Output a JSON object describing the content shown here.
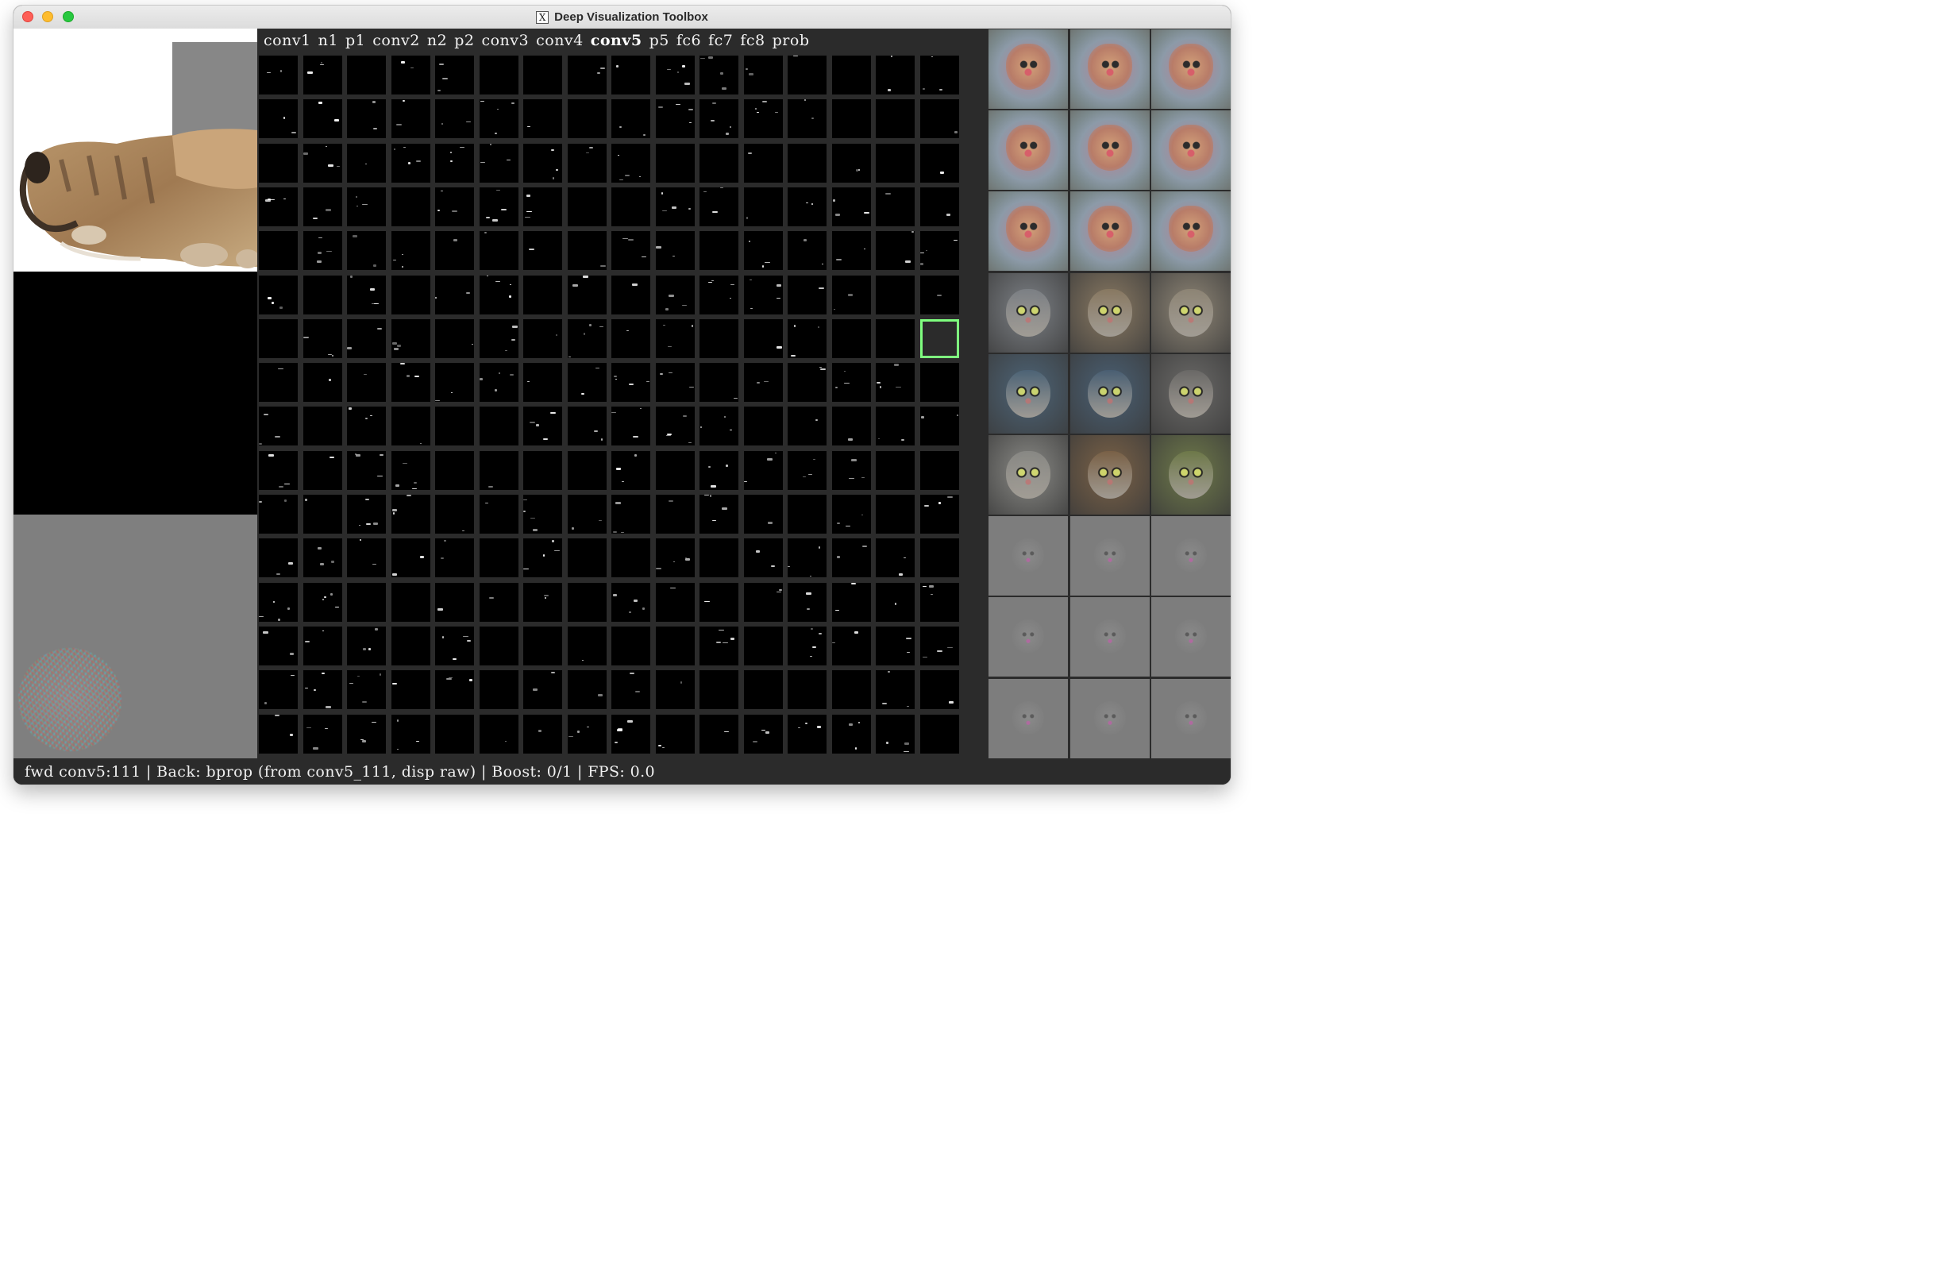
{
  "window": {
    "title": "Deep Visualization Toolbox",
    "title_icon": "X"
  },
  "layers": [
    {
      "label": "conv1",
      "active": false
    },
    {
      "label": "n1",
      "active": false
    },
    {
      "label": "p1",
      "active": false
    },
    {
      "label": "conv2",
      "active": false
    },
    {
      "label": "n2",
      "active": false
    },
    {
      "label": "p2",
      "active": false
    },
    {
      "label": "conv3",
      "active": false
    },
    {
      "label": "conv4",
      "active": false
    },
    {
      "label": "conv5",
      "active": true
    },
    {
      "label": "p5",
      "active": false
    },
    {
      "label": "fc6",
      "active": false
    },
    {
      "label": "fc7",
      "active": false
    },
    {
      "label": "fc8",
      "active": false
    },
    {
      "label": "prob",
      "active": false
    }
  ],
  "activation_grid": {
    "selected_unit": 111,
    "highlight_color": "#7fff7f"
  },
  "right_panel": {
    "tiles": [
      {
        "kind": "deepvis"
      },
      {
        "kind": "deepvis"
      },
      {
        "kind": "deepvis"
      },
      {
        "kind": "deepvis"
      },
      {
        "kind": "deepvis"
      },
      {
        "kind": "deepvis"
      },
      {
        "kind": "deepvis"
      },
      {
        "kind": "deepvis"
      },
      {
        "kind": "deepvis"
      },
      {
        "kind": "photo",
        "color": "#7d8186"
      },
      {
        "kind": "photo",
        "color": "#8a7a63"
      },
      {
        "kind": "photo",
        "color": "#8f8676"
      },
      {
        "kind": "photo",
        "color": "#4d6477"
      },
      {
        "kind": "photo",
        "color": "#4a6074"
      },
      {
        "kind": "photo",
        "color": "#6b6a68"
      },
      {
        "kind": "photo",
        "color": "#8a8a86"
      },
      {
        "kind": "photo",
        "color": "#7b6247"
      },
      {
        "kind": "photo",
        "color": "#6f7a4a"
      },
      {
        "kind": "gradvis"
      },
      {
        "kind": "gradvis"
      },
      {
        "kind": "gradvis"
      },
      {
        "kind": "gradvis"
      },
      {
        "kind": "gradvis"
      },
      {
        "kind": "gradvis"
      },
      {
        "kind": "gradvis"
      },
      {
        "kind": "gradvis"
      },
      {
        "kind": "gradvis"
      }
    ]
  },
  "status": {
    "text": "fwd conv5:111 | Back: bprop (from conv5_111, disp raw) | Boost: 0/1 | FPS: 0.0"
  }
}
